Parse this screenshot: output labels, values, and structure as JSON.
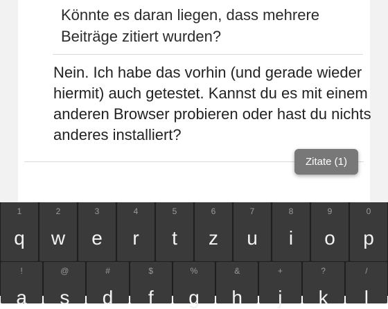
{
  "thread": {
    "quote_text": "Könnte es daran liegen, dass mehrere Beiträge zitiert wurden?",
    "reply_text": "Nein. Ich habe das vorhin (und gerade wieder hiermit) auch getestet. Kannst du es mit einem anderen Browser probieren oder hast du nichts anderes installiert?",
    "quote_button": "Zitate (1)"
  },
  "keyboard": {
    "row1": [
      {
        "hint": "1",
        "key": "q"
      },
      {
        "hint": "2",
        "key": "w"
      },
      {
        "hint": "3",
        "key": "e"
      },
      {
        "hint": "4",
        "key": "r"
      },
      {
        "hint": "5",
        "key": "t"
      },
      {
        "hint": "6",
        "key": "z"
      },
      {
        "hint": "7",
        "key": "u"
      },
      {
        "hint": "8",
        "key": "i"
      },
      {
        "hint": "9",
        "key": "o"
      },
      {
        "hint": "0",
        "key": "p"
      }
    ],
    "row2": [
      {
        "hint": "!",
        "key": "a"
      },
      {
        "hint": "@",
        "key": "s"
      },
      {
        "hint": "#",
        "key": "d"
      },
      {
        "hint": "$",
        "key": "f"
      },
      {
        "hint": "%",
        "key": "g"
      },
      {
        "hint": "&",
        "key": "h"
      },
      {
        "hint": "+",
        "key": "j"
      },
      {
        "hint": "?",
        "key": "k"
      },
      {
        "hint": "/",
        "key": "l"
      }
    ]
  },
  "colors": {
    "keyboard_bg": "#1f1f1f",
    "key_bg": "#3a3a3a",
    "toast_bg": "#787878"
  }
}
